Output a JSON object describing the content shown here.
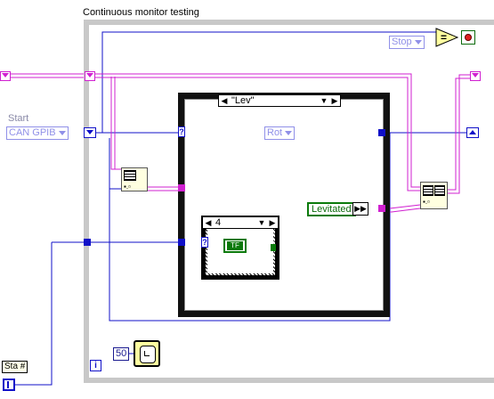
{
  "diagram": {
    "loop_title": "Continuous monitor testing",
    "start_label": "Start",
    "start_enum_value": "CAN GPIB",
    "stop_enum_value": "Stop",
    "rot_enum_value": "Rot",
    "case_selector_value": "\"Lev\"",
    "inner_case_value": "4",
    "levitated_const": "Levitated",
    "bool_const": "TF",
    "wait_ms": "50",
    "sta_label": "Sta #",
    "iteration_label": "i",
    "query_mark": "?"
  },
  "colors": {
    "enum_wire": "#1010c8",
    "string_wire": "#d020d0",
    "bool_wire": "#0a7a0a",
    "loop_border": "#c8c8c8"
  }
}
